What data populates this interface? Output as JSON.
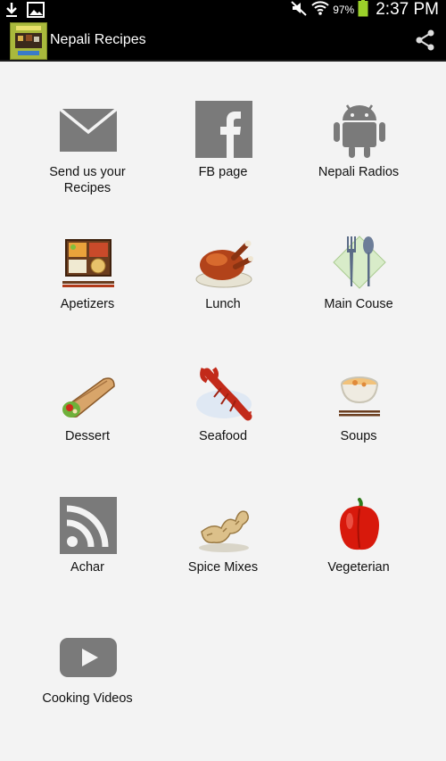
{
  "status_bar": {
    "battery_percent": "97%",
    "time": "2:37 PM"
  },
  "action_bar": {
    "title": "Nepali Recipes",
    "share_icon": "share-icon"
  },
  "menu": [
    {
      "label": "Send us your\nRecipes",
      "icon": "envelope-icon"
    },
    {
      "label": "FB page",
      "icon": "facebook-icon"
    },
    {
      "label": "Nepali Radios",
      "icon": "android-icon"
    },
    {
      "label": "Apetizers",
      "icon": "bento-box-icon"
    },
    {
      "label": "Lunch",
      "icon": "roast-chicken-icon"
    },
    {
      "label": "Main Couse",
      "icon": "fork-spoon-icon"
    },
    {
      "label": "Dessert",
      "icon": "burrito-icon"
    },
    {
      "label": "Seafood",
      "icon": "lobster-icon"
    },
    {
      "label": "Soups",
      "icon": "soup-bowl-icon"
    },
    {
      "label": "Achar",
      "icon": "rss-icon"
    },
    {
      "label": "Spice Mixes",
      "icon": "ginger-icon"
    },
    {
      "label": "Vegeterian",
      "icon": "bell-pepper-icon"
    },
    {
      "label": "Cooking Videos",
      "icon": "video-play-icon"
    }
  ]
}
